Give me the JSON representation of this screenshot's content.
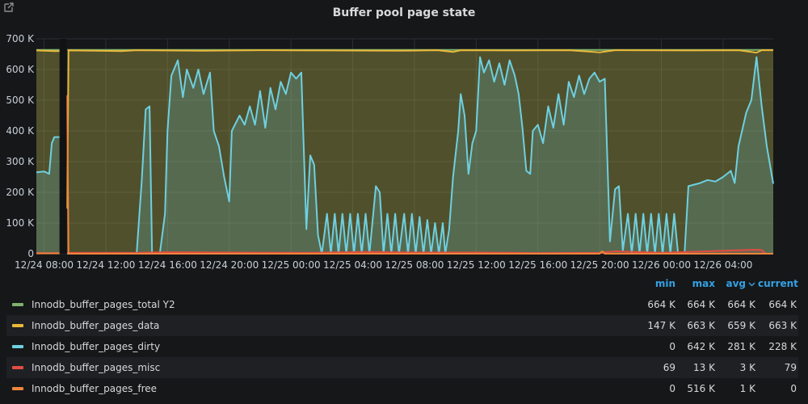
{
  "panel": {
    "title": "Buffer pool page state"
  },
  "legend": {
    "headers": {
      "min": "min",
      "max": "max",
      "avg": "avg",
      "current": "current"
    },
    "rows": [
      {
        "name": "Innodb_buffer_pages_total Y2",
        "color": "#7eb26d",
        "min": "664 K",
        "max": "664 K",
        "avg": "664 K",
        "current": "664 K"
      },
      {
        "name": "Innodb_buffer_pages_data",
        "color": "#eab839",
        "min": "147 K",
        "max": "663 K",
        "avg": "659 K",
        "current": "663 K"
      },
      {
        "name": "Innodb_buffer_pages_dirty",
        "color": "#6ed0e0",
        "min": "0",
        "max": "642 K",
        "avg": "281 K",
        "current": "228 K"
      },
      {
        "name": "Innodb_buffer_pages_misc",
        "color": "#e24d42",
        "min": "69",
        "max": "13 K",
        "avg": "3 K",
        "current": "79"
      },
      {
        "name": "Innodb_buffer_pages_free",
        "color": "#ef843c",
        "min": "0",
        "max": "516 K",
        "avg": "1 K",
        "current": "0"
      }
    ]
  },
  "chart_data": {
    "type": "area",
    "title": "Buffer pool page state",
    "xlim": [
      "2024-12-24 07:30",
      "2024-12-26 07:15"
    ],
    "ylim": [
      0,
      700000
    ],
    "grid": true,
    "legend_position": "bottom",
    "x_ticks": [
      "12/24 08:00",
      "12/24 12:00",
      "12/24 16:00",
      "12/24 20:00",
      "12/25 00:00",
      "12/25 04:00",
      "12/25 08:00",
      "12/25 12:00",
      "12/25 16:00",
      "12/25 20:00",
      "12/26 00:00",
      "12/26 04:00"
    ],
    "y_ticks": [
      "0",
      "100 K",
      "200 K",
      "300 K",
      "400 K",
      "500 K",
      "600 K",
      "700 K"
    ],
    "gaps": [
      [
        "2024-12-24 09:00",
        "2024-12-24 09:30"
      ]
    ],
    "series": [
      {
        "name": "Innodb_buffer_pages_total Y2",
        "color": "#7eb26d",
        "points": [
          [
            "2024-12-24 07:30",
            664000
          ],
          [
            "2024-12-24 09:00",
            664000
          ],
          [
            "2024-12-24 09:30",
            664000
          ],
          [
            "2024-12-26 07:15",
            664000
          ]
        ]
      },
      {
        "name": "Innodb_buffer_pages_data",
        "color": "#eab839",
        "points": [
          [
            "2024-12-24 07:30",
            662000
          ],
          [
            "2024-12-24 08:00",
            661000
          ],
          [
            "2024-12-24 08:40",
            660000
          ],
          [
            "2024-12-24 09:00",
            660000
          ],
          [
            "2024-12-24 09:30",
            147000
          ],
          [
            "2024-12-24 09:35",
            662000
          ],
          [
            "2024-12-24 13:00",
            660000
          ],
          [
            "2024-12-24 14:00",
            663000
          ],
          [
            "2024-12-24 18:00",
            661000
          ],
          [
            "2024-12-24 22:00",
            663000
          ],
          [
            "2024-12-25 02:00",
            662000
          ],
          [
            "2024-12-25 07:00",
            661000
          ],
          [
            "2024-12-25 09:30",
            663000
          ],
          [
            "2024-12-25 10:30",
            657000
          ],
          [
            "2024-12-25 11:00",
            663000
          ],
          [
            "2024-12-25 14:00",
            662000
          ],
          [
            "2024-12-25 18:00",
            663000
          ],
          [
            "2024-12-25 20:00",
            656000
          ],
          [
            "2024-12-25 21:00",
            663000
          ],
          [
            "2024-12-26 02:00",
            662000
          ],
          [
            "2024-12-26 05:00",
            663000
          ],
          [
            "2024-12-26 06:10",
            655000
          ],
          [
            "2024-12-26 06:30",
            663000
          ],
          [
            "2024-12-26 07:15",
            663000
          ]
        ]
      },
      {
        "name": "Innodb_buffer_pages_dirty",
        "color": "#6ed0e0",
        "points": [
          [
            "2024-12-24 07:30",
            265000
          ],
          [
            "2024-12-24 08:00",
            268000
          ],
          [
            "2024-12-24 08:20",
            260000
          ],
          [
            "2024-12-24 08:30",
            360000
          ],
          [
            "2024-12-24 08:40",
            380000
          ],
          [
            "2024-12-24 09:00",
            380000
          ],
          [
            "2024-12-24 09:30",
            0
          ],
          [
            "2024-12-24 14:00",
            0
          ],
          [
            "2024-12-24 14:20",
            240000
          ],
          [
            "2024-12-24 14:35",
            470000
          ],
          [
            "2024-12-24 14:50",
            480000
          ],
          [
            "2024-12-24 15:00",
            0
          ],
          [
            "2024-12-24 15:30",
            0
          ],
          [
            "2024-12-24 15:50",
            130000
          ],
          [
            "2024-12-24 16:00",
            400000
          ],
          [
            "2024-12-24 16:15",
            580000
          ],
          [
            "2024-12-24 16:40",
            630000
          ],
          [
            "2024-12-24 17:00",
            510000
          ],
          [
            "2024-12-24 17:15",
            600000
          ],
          [
            "2024-12-24 17:40",
            540000
          ],
          [
            "2024-12-24 18:00",
            600000
          ],
          [
            "2024-12-24 18:20",
            520000
          ],
          [
            "2024-12-24 18:45",
            590000
          ],
          [
            "2024-12-24 19:00",
            400000
          ],
          [
            "2024-12-24 19:20",
            350000
          ],
          [
            "2024-12-24 19:40",
            250000
          ],
          [
            "2024-12-24 20:00",
            170000
          ],
          [
            "2024-12-24 20:10",
            400000
          ],
          [
            "2024-12-24 20:40",
            450000
          ],
          [
            "2024-12-24 21:00",
            420000
          ],
          [
            "2024-12-24 21:20",
            480000
          ],
          [
            "2024-12-24 21:40",
            420000
          ],
          [
            "2024-12-24 22:00",
            530000
          ],
          [
            "2024-12-24 22:20",
            410000
          ],
          [
            "2024-12-24 22:40",
            540000
          ],
          [
            "2024-12-24 23:00",
            470000
          ],
          [
            "2024-12-24 23:20",
            560000
          ],
          [
            "2024-12-24 23:40",
            520000
          ],
          [
            "2024-12-25 00:00",
            590000
          ],
          [
            "2024-12-25 00:20",
            570000
          ],
          [
            "2024-12-25 00:40",
            590000
          ],
          [
            "2024-12-25 01:00",
            80000
          ],
          [
            "2024-12-25 01:15",
            320000
          ],
          [
            "2024-12-25 01:30",
            290000
          ],
          [
            "2024-12-25 01:45",
            60000
          ],
          [
            "2024-12-25 02:00",
            0
          ],
          [
            "2024-12-25 02:20",
            130000
          ],
          [
            "2024-12-25 02:35",
            0
          ],
          [
            "2024-12-25 02:50",
            130000
          ],
          [
            "2024-12-25 03:05",
            0
          ],
          [
            "2024-12-25 03:20",
            130000
          ],
          [
            "2024-12-25 03:35",
            0
          ],
          [
            "2024-12-25 03:50",
            130000
          ],
          [
            "2024-12-25 04:05",
            0
          ],
          [
            "2024-12-25 04:20",
            130000
          ],
          [
            "2024-12-25 04:35",
            0
          ],
          [
            "2024-12-25 04:50",
            130000
          ],
          [
            "2024-12-25 05:05",
            0
          ],
          [
            "2024-12-25 05:30",
            220000
          ],
          [
            "2024-12-25 05:45",
            200000
          ],
          [
            "2024-12-25 06:00",
            0
          ],
          [
            "2024-12-25 06:15",
            130000
          ],
          [
            "2024-12-25 06:30",
            0
          ],
          [
            "2024-12-25 06:45",
            130000
          ],
          [
            "2024-12-25 07:00",
            0
          ],
          [
            "2024-12-25 07:20",
            130000
          ],
          [
            "2024-12-25 07:35",
            0
          ],
          [
            "2024-12-25 07:50",
            130000
          ],
          [
            "2024-12-25 08:05",
            0
          ],
          [
            "2024-12-25 08:20",
            120000
          ],
          [
            "2024-12-25 08:35",
            0
          ],
          [
            "2024-12-25 08:50",
            110000
          ],
          [
            "2024-12-25 09:05",
            0
          ],
          [
            "2024-12-25 09:20",
            100000
          ],
          [
            "2024-12-25 09:35",
            0
          ],
          [
            "2024-12-25 09:50",
            100000
          ],
          [
            "2024-12-25 10:00",
            0
          ],
          [
            "2024-12-25 10:15",
            80000
          ],
          [
            "2024-12-25 10:30",
            250000
          ],
          [
            "2024-12-25 10:50",
            400000
          ],
          [
            "2024-12-25 11:00",
            520000
          ],
          [
            "2024-12-25 11:15",
            450000
          ],
          [
            "2024-12-25 11:30",
            260000
          ],
          [
            "2024-12-25 11:45",
            360000
          ],
          [
            "2024-12-25 12:00",
            400000
          ],
          [
            "2024-12-25 12:15",
            640000
          ],
          [
            "2024-12-25 12:30",
            590000
          ],
          [
            "2024-12-25 12:50",
            630000
          ],
          [
            "2024-12-25 13:10",
            560000
          ],
          [
            "2024-12-25 13:30",
            620000
          ],
          [
            "2024-12-25 13:50",
            550000
          ],
          [
            "2024-12-25 14:10",
            630000
          ],
          [
            "2024-12-25 14:30",
            580000
          ],
          [
            "2024-12-25 14:45",
            520000
          ],
          [
            "2024-12-25 15:00",
            410000
          ],
          [
            "2024-12-25 15:15",
            270000
          ],
          [
            "2024-12-25 15:30",
            260000
          ],
          [
            "2024-12-25 15:40",
            400000
          ],
          [
            "2024-12-25 16:00",
            420000
          ],
          [
            "2024-12-25 16:20",
            360000
          ],
          [
            "2024-12-25 16:40",
            480000
          ],
          [
            "2024-12-25 17:00",
            410000
          ],
          [
            "2024-12-25 17:20",
            520000
          ],
          [
            "2024-12-25 17:40",
            420000
          ],
          [
            "2024-12-25 18:00",
            560000
          ],
          [
            "2024-12-25 18:20",
            510000
          ],
          [
            "2024-12-25 18:40",
            580000
          ],
          [
            "2024-12-25 19:00",
            520000
          ],
          [
            "2024-12-25 19:20",
            570000
          ],
          [
            "2024-12-25 19:40",
            590000
          ],
          [
            "2024-12-25 20:00",
            560000
          ],
          [
            "2024-12-25 20:20",
            570000
          ],
          [
            "2024-12-25 20:40",
            40000
          ],
          [
            "2024-12-25 21:00",
            210000
          ],
          [
            "2024-12-25 21:15",
            220000
          ],
          [
            "2024-12-25 21:30",
            10000
          ],
          [
            "2024-12-25 21:50",
            130000
          ],
          [
            "2024-12-25 22:05",
            0
          ],
          [
            "2024-12-25 22:20",
            130000
          ],
          [
            "2024-12-25 22:35",
            0
          ],
          [
            "2024-12-25 22:50",
            130000
          ],
          [
            "2024-12-25 23:05",
            0
          ],
          [
            "2024-12-25 23:20",
            130000
          ],
          [
            "2024-12-25 23:35",
            0
          ],
          [
            "2024-12-25 23:50",
            130000
          ],
          [
            "2024-12-26 00:05",
            0
          ],
          [
            "2024-12-26 00:20",
            130000
          ],
          [
            "2024-12-26 00:35",
            0
          ],
          [
            "2024-12-26 00:50",
            130000
          ],
          [
            "2024-12-26 01:05",
            0
          ],
          [
            "2024-12-26 01:30",
            0
          ],
          [
            "2024-12-26 01:45",
            220000
          ],
          [
            "2024-12-26 02:30",
            230000
          ],
          [
            "2024-12-26 03:00",
            240000
          ],
          [
            "2024-12-26 03:30",
            235000
          ],
          [
            "2024-12-26 04:00",
            250000
          ],
          [
            "2024-12-26 04:30",
            270000
          ],
          [
            "2024-12-26 04:45",
            230000
          ],
          [
            "2024-12-26 05:00",
            350000
          ],
          [
            "2024-12-26 05:30",
            460000
          ],
          [
            "2024-12-26 05:50",
            500000
          ],
          [
            "2024-12-26 06:10",
            640000
          ],
          [
            "2024-12-26 06:30",
            480000
          ],
          [
            "2024-12-26 06:50",
            350000
          ],
          [
            "2024-12-26 07:15",
            228000
          ]
        ]
      },
      {
        "name": "Innodb_buffer_pages_misc",
        "color": "#e24d42",
        "points": [
          [
            "2024-12-24 07:30",
            2000
          ],
          [
            "2024-12-24 09:00",
            2000
          ],
          [
            "2024-12-24 09:30",
            3000
          ],
          [
            "2024-12-24 14:00",
            3000
          ],
          [
            "2024-12-24 16:00",
            5000
          ],
          [
            "2024-12-25 01:00",
            3000
          ],
          [
            "2024-12-25 05:00",
            6000
          ],
          [
            "2024-12-25 08:00",
            4000
          ],
          [
            "2024-12-25 12:00",
            4000
          ],
          [
            "2024-12-25 16:00",
            2000
          ],
          [
            "2024-12-25 20:00",
            3000
          ],
          [
            "2024-12-25 21:00",
            8000
          ],
          [
            "2024-12-26 00:00",
            3000
          ],
          [
            "2024-12-26 06:00",
            13000
          ],
          [
            "2024-12-26 06:30",
            12000
          ],
          [
            "2024-12-26 06:45",
            100
          ],
          [
            "2024-12-26 07:15",
            79
          ]
        ]
      },
      {
        "name": "Innodb_buffer_pages_free",
        "color": "#ef843c",
        "points": [
          [
            "2024-12-24 07:30",
            1000
          ],
          [
            "2024-12-24 09:00",
            1000
          ],
          [
            "2024-12-24 09:30",
            516000
          ],
          [
            "2024-12-24 09:35",
            0
          ],
          [
            "2024-12-25 20:00",
            0
          ],
          [
            "2024-12-25 20:10",
            8000
          ],
          [
            "2024-12-25 20:20",
            0
          ],
          [
            "2024-12-26 06:00",
            0
          ],
          [
            "2024-12-26 07:15",
            0
          ]
        ]
      }
    ]
  }
}
